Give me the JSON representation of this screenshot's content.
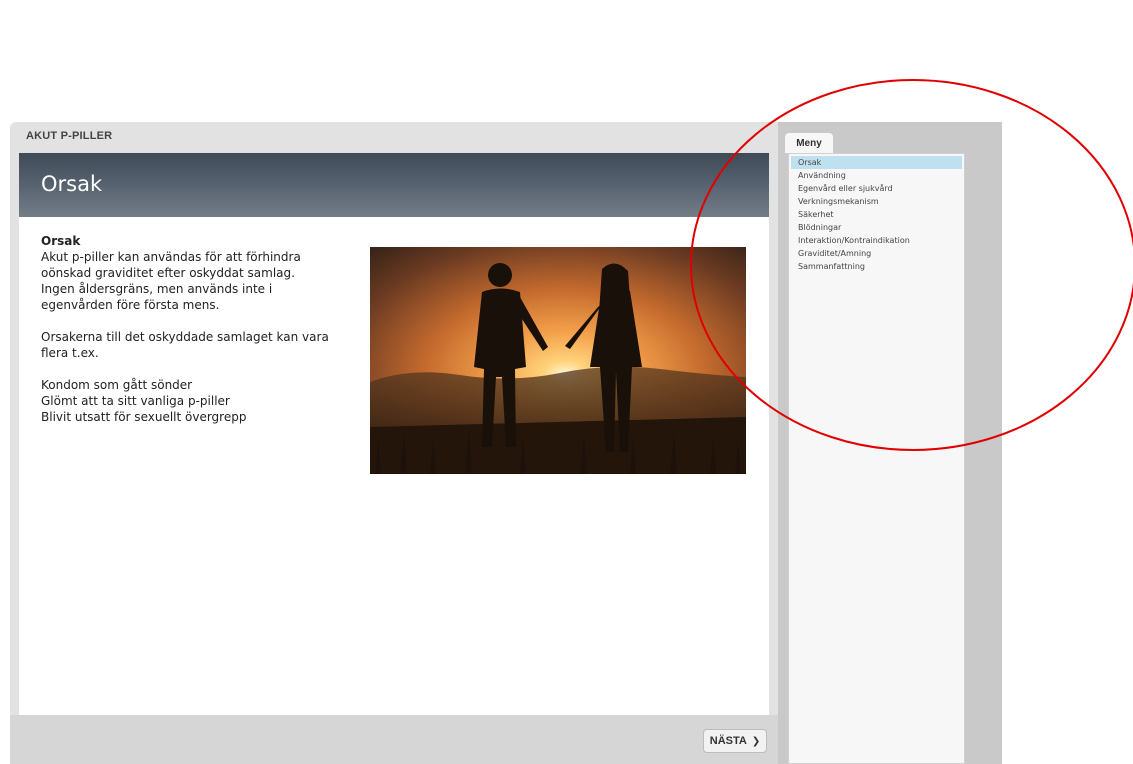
{
  "course": {
    "title": "AKUT P-PILLER"
  },
  "slide": {
    "header_title": "Orsak",
    "heading": "Orsak",
    "paragraph1": [
      "Akut p-piller kan användas för att förhindra",
      "oönskad graviditet efter oskyddat samlag.",
      "Ingen åldersgräns, men används inte i",
      "egenvården före första mens."
    ],
    "paragraph2": [
      "Orsakerna till det oskyddade samlaget kan vara",
      "flera t.ex."
    ],
    "paragraph3": [
      "Kondom som gått sönder",
      "Glömt att ta sitt vanliga p-piller",
      "Blivit utsatt för sexuellt övergrepp"
    ]
  },
  "navigation": {
    "next_label": "NÄSTA",
    "next_icon": "chevron-right-icon"
  },
  "menu": {
    "tab_label": "Meny",
    "items": [
      {
        "label": "Orsak",
        "active": true
      },
      {
        "label": "Användning",
        "active": false
      },
      {
        "label": "Egenvård eller sjukvård",
        "active": false
      },
      {
        "label": "Verkningsmekanism",
        "active": false
      },
      {
        "label": "Säkerhet",
        "active": false
      },
      {
        "label": "Blödningar",
        "active": false
      },
      {
        "label": "Interaktion/Kontraindikation",
        "active": false
      },
      {
        "label": "Graviditet/Amning",
        "active": false
      },
      {
        "label": "Sammanfattning",
        "active": false
      }
    ]
  },
  "colors": {
    "active_menu_bg": "#bfe0ef",
    "header_band": "#4a5562",
    "annotation_circle": "#e00000"
  }
}
